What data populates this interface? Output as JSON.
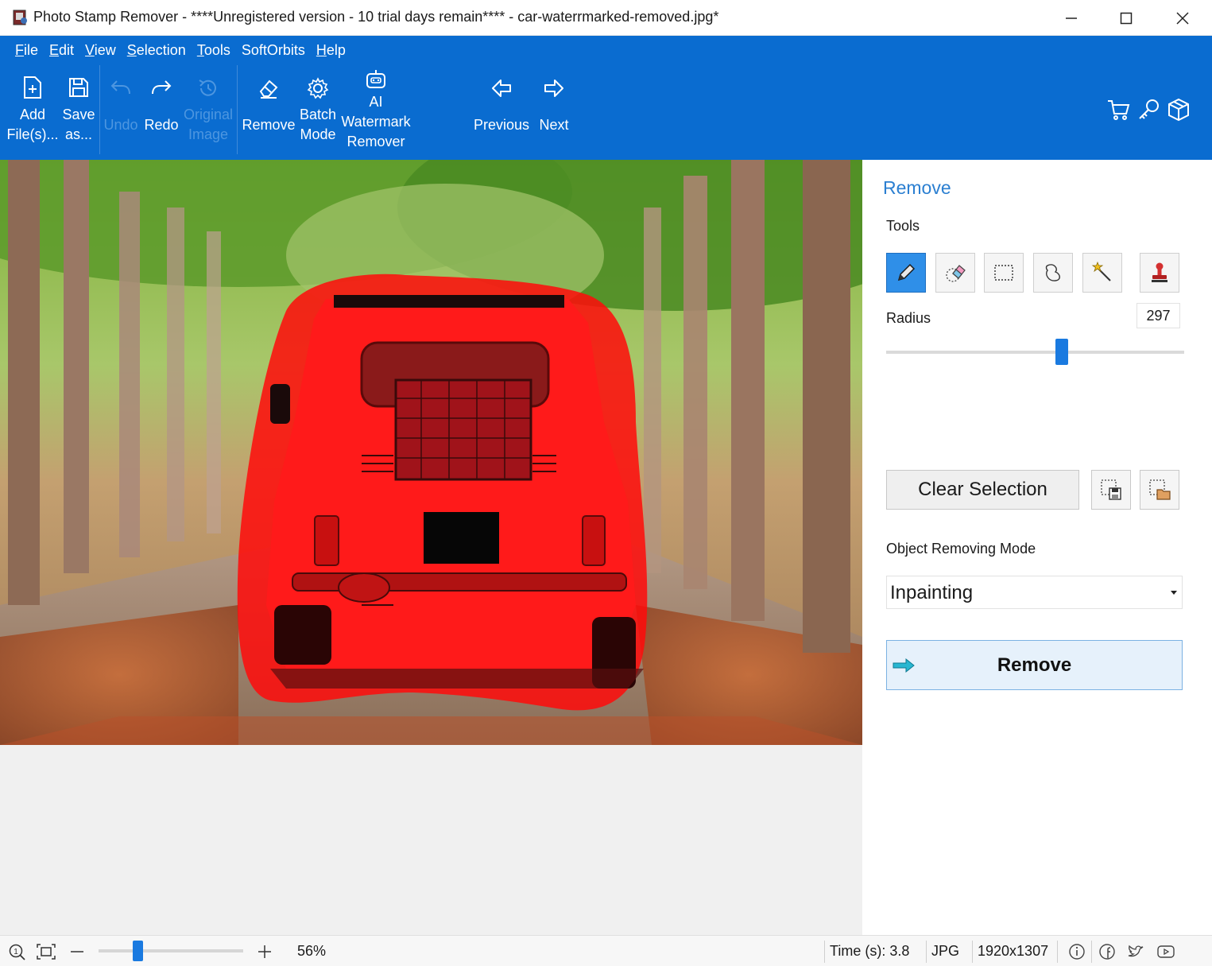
{
  "window": {
    "title": "Photo Stamp Remover - ****Unregistered version - 10 trial days remain**** - car-waterrmarked-removed.jpg*",
    "controls": [
      "minimize-icon",
      "maximize-icon",
      "close-icon"
    ]
  },
  "menu": {
    "items": [
      {
        "first": "F",
        "rest": "ile"
      },
      {
        "first": "E",
        "rest": "dit"
      },
      {
        "first": "V",
        "rest": "iew"
      },
      {
        "first": "S",
        "rest": "election"
      },
      {
        "first": "T",
        "rest": "ools"
      },
      {
        "first": "",
        "rest": "SoftOrbits"
      },
      {
        "first": "H",
        "rest": "elp"
      }
    ]
  },
  "toolbar": {
    "add_files": "Add\nFile(s)...",
    "save_as": "Save\nas...",
    "undo": "Undo",
    "redo": "Redo",
    "original_image": "Original\nImage",
    "remove": "Remove",
    "batch_mode": "Batch\nMode",
    "ai_watermark_remover": "AI\nWatermark\nRemover",
    "previous": "Previous",
    "next": "Next",
    "right_icons": [
      "cart-icon",
      "key-icon",
      "box-icon"
    ]
  },
  "panel": {
    "title": "Remove",
    "tools_label": "Tools",
    "tools": [
      {
        "name": "pencil-icon",
        "active": true
      },
      {
        "name": "eraser-icon",
        "active": false
      },
      {
        "name": "rectangle-select-icon",
        "active": false
      },
      {
        "name": "lasso-icon",
        "active": false
      },
      {
        "name": "magic-wand-icon",
        "active": false
      },
      {
        "name": "stamp-icon",
        "active": false
      }
    ],
    "radius_label": "Radius",
    "radius_value": "297",
    "radius_fraction": 0.59,
    "clear_selection": "Clear Selection",
    "mode_label": "Object Removing Mode",
    "mode_value": "Inpainting",
    "remove_button": "Remove"
  },
  "status": {
    "zoom": "56%",
    "zoom_fraction": 0.27,
    "time": "Time (s): 3.8",
    "format": "JPG",
    "dimensions": "1920x1307",
    "icons": [
      "zoom-fit-icon",
      "fit-window-icon",
      "zoom-out-icon",
      "zoom-in-icon",
      "info-icon",
      "facebook-icon",
      "twitter-icon",
      "youtube-icon"
    ]
  },
  "colors": {
    "ribbon": "#0a6cd0",
    "accent": "#2b7fd1",
    "selection_overlay": "#ff0000"
  }
}
